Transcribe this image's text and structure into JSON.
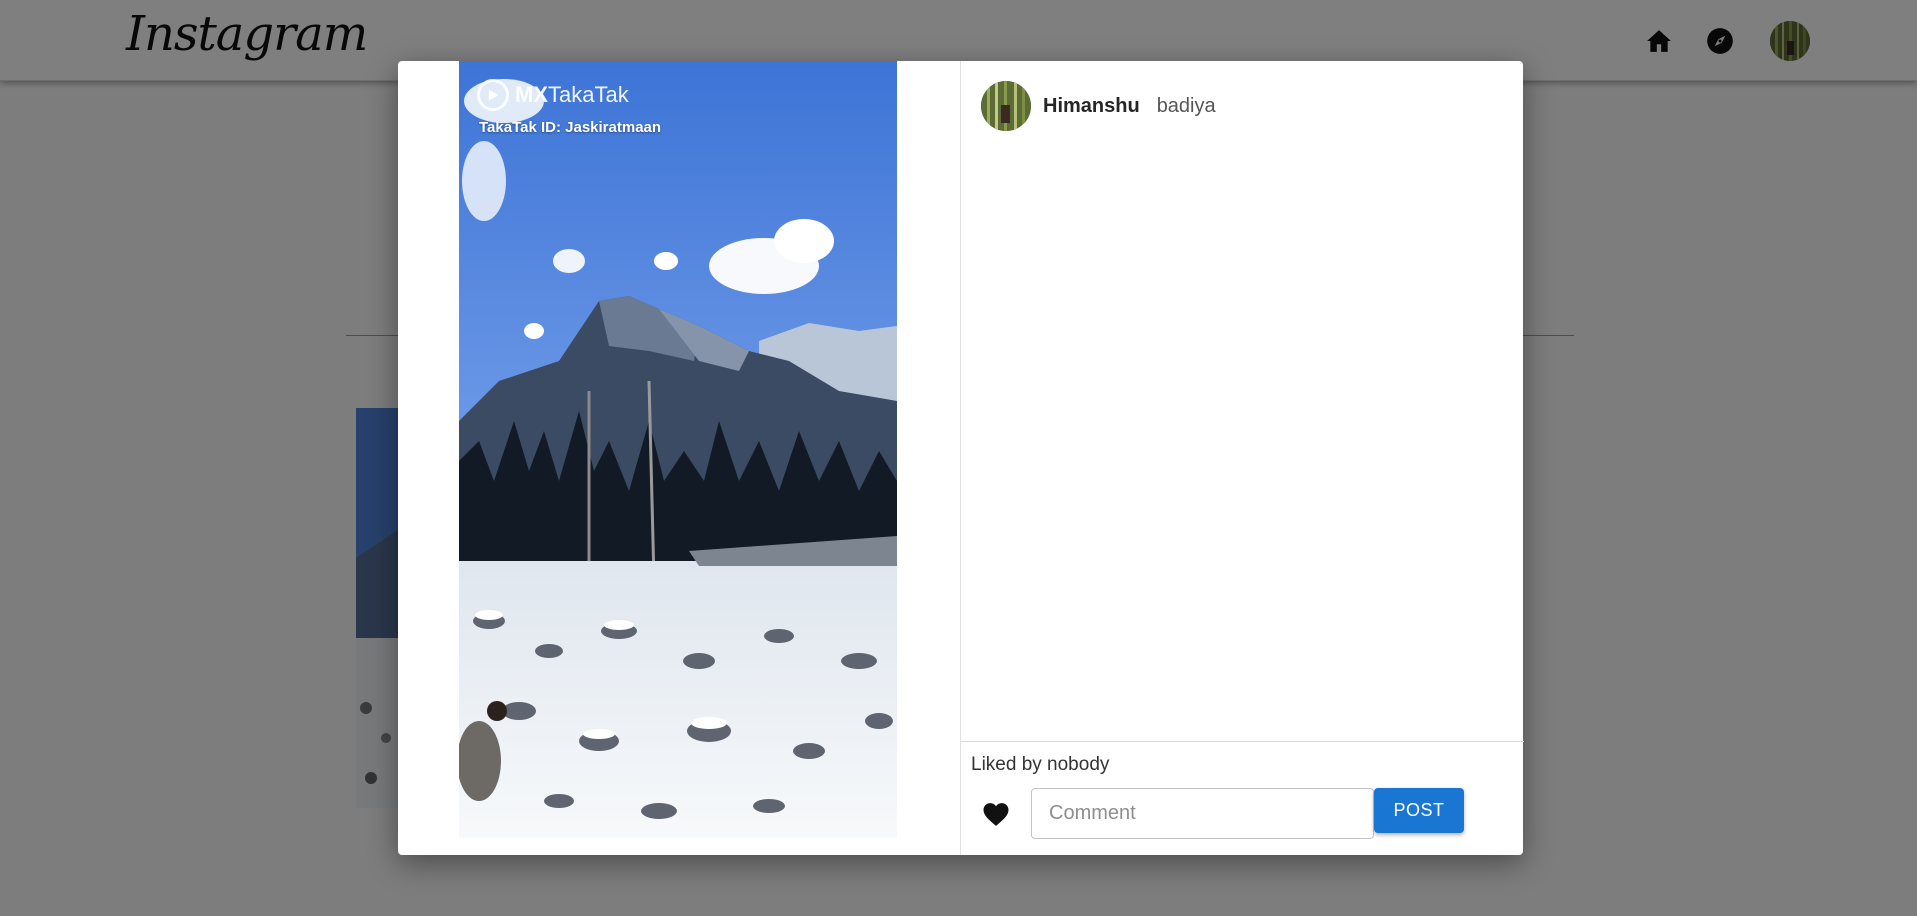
{
  "header": {
    "logo_text": "Instagram",
    "icons": {
      "home": "home-icon",
      "explore": "compass-icon",
      "avatar": "profile-avatar"
    }
  },
  "post_modal": {
    "media": {
      "watermark_brand_prefix": "MX",
      "watermark_brand_suffix": "TakaTak",
      "watermark_id": "TakaTak ID: Jaskiratmaan"
    },
    "comments": [
      {
        "username": "Himanshu",
        "text": "badiya"
      }
    ],
    "likes_text": "Liked by nobody",
    "comment_input": {
      "placeholder": "Comment",
      "value": ""
    },
    "post_label": "POST"
  },
  "colors": {
    "accent": "#1976d2",
    "overlay": "rgba(0,0,0,0.5)",
    "sky": "#5b8be0"
  }
}
